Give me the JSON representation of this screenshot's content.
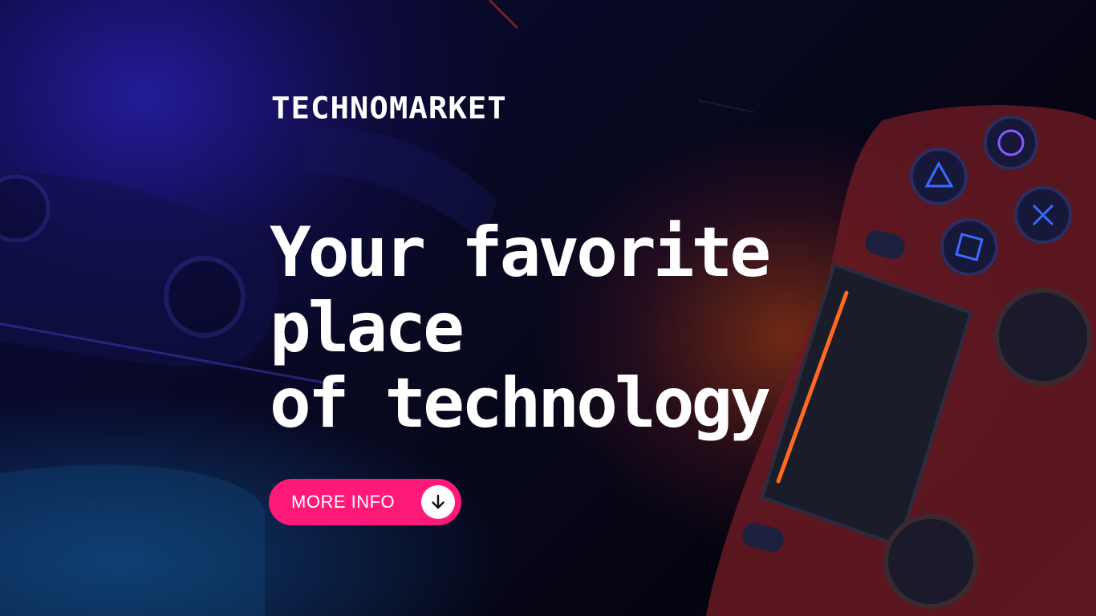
{
  "brand": {
    "name": "TECHNOMARKET"
  },
  "hero": {
    "headline_lines": [
      "Your favorite",
      "place",
      "of technology"
    ]
  },
  "cta": {
    "label": "MORE INFO",
    "icon": "arrow-down-icon"
  },
  "colors": {
    "accent": "#ff1a7a",
    "text": "#ffffff",
    "background_dark": "#05051a",
    "glow_orange": "#c84614",
    "glow_blue": "#2820aa"
  }
}
